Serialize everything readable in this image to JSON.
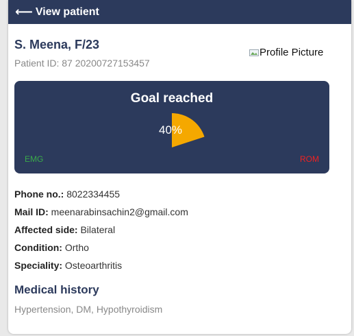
{
  "header": {
    "back_icon": "arrow-left-icon",
    "back_glyph": "⟵",
    "title": "View patient"
  },
  "patient": {
    "name": "S. Meena, F/23",
    "id_text": "Patient ID: 87 20200727153457",
    "profile_alt": "Profile Picture"
  },
  "goal": {
    "title": "Goal reached",
    "percent_label": "40%",
    "progress": 0.4,
    "left_label": "EMG",
    "right_label": "ROM",
    "fill_color": "#f5a800"
  },
  "details": [
    {
      "label": "Phone no.:",
      "value": "8022334455"
    },
    {
      "label": "Mail ID:",
      "value": "meenarabinsachin2@gmail.com"
    },
    {
      "label": "Affected side:",
      "value": "Bilateral"
    },
    {
      "label": "Condition:",
      "value": "Ortho"
    },
    {
      "label": "Speciality:",
      "value": "Osteoarthritis"
    }
  ],
  "medical_history": {
    "title": "Medical history",
    "text": "Hypertension, DM, Hypothyroidism"
  },
  "colors": {
    "navy": "#2c3a5c",
    "emg_green": "#3aaa4a",
    "rom_red": "#ee2222"
  }
}
